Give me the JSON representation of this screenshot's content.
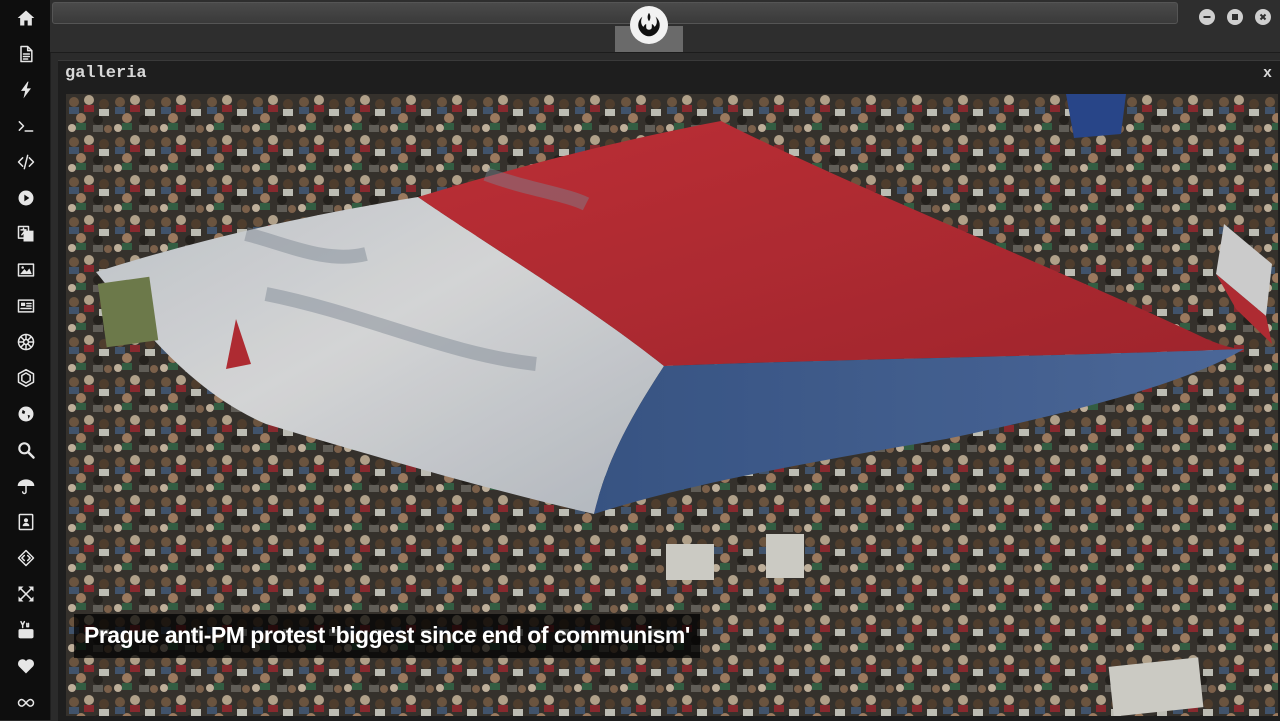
{
  "sidebar": {
    "items": [
      {
        "icon": "home-icon"
      },
      {
        "icon": "document-icon"
      },
      {
        "icon": "lightning-icon"
      },
      {
        "icon": "terminal-icon"
      },
      {
        "icon": "code-icon"
      },
      {
        "icon": "play-icon"
      },
      {
        "icon": "translate-icon"
      },
      {
        "icon": "image-icon"
      },
      {
        "icon": "newspaper-icon"
      },
      {
        "icon": "empire-icon"
      },
      {
        "icon": "hexagon-icon"
      },
      {
        "icon": "globe-icon"
      },
      {
        "icon": "search-icon"
      },
      {
        "icon": "umbrella-icon"
      },
      {
        "icon": "contact-card-icon"
      },
      {
        "icon": "embed-icon"
      },
      {
        "icon": "fullscreen-icon"
      },
      {
        "icon": "youtube-icon"
      },
      {
        "icon": "heart-icon"
      },
      {
        "icon": "infinity-cloud-icon"
      }
    ]
  },
  "header": {
    "logo_icon": "rebel-alliance-icon",
    "window_controls": [
      "minimize-icon",
      "maximize-icon",
      "close-icon"
    ]
  },
  "gallery": {
    "title": "galleria",
    "close_label": "x",
    "caption": "Prague anti-PM protest 'biggest since end of communism'"
  },
  "colors": {
    "flag_red": "#c7323a",
    "flag_white": "#e9ecef",
    "flag_blue": "#4d6fa6",
    "sidebar_bg": "#0e0e0e",
    "panel_bg": "#1e1e1e"
  }
}
